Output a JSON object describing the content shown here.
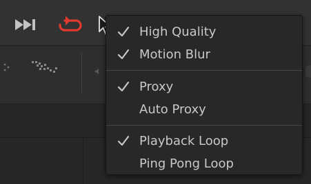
{
  "colors": {
    "accent_red": "#e23a2f",
    "text": "#c9c9c9",
    "menu_bg": "#282828",
    "separator": "#454545"
  },
  "toolbar": {
    "icons": [
      "next-frame-icon",
      "loop-icon",
      "mouse-cursor-icon"
    ]
  },
  "menu": {
    "groups": [
      {
        "items": [
          {
            "label": "High Quality",
            "checked": true
          },
          {
            "label": "Motion Blur",
            "checked": true
          }
        ]
      },
      {
        "items": [
          {
            "label": "Proxy",
            "checked": true
          },
          {
            "label": "Auto Proxy",
            "checked": false
          }
        ]
      },
      {
        "items": [
          {
            "label": "Playback Loop",
            "checked": true
          },
          {
            "label": "Ping Pong Loop",
            "checked": false
          }
        ]
      }
    ]
  }
}
